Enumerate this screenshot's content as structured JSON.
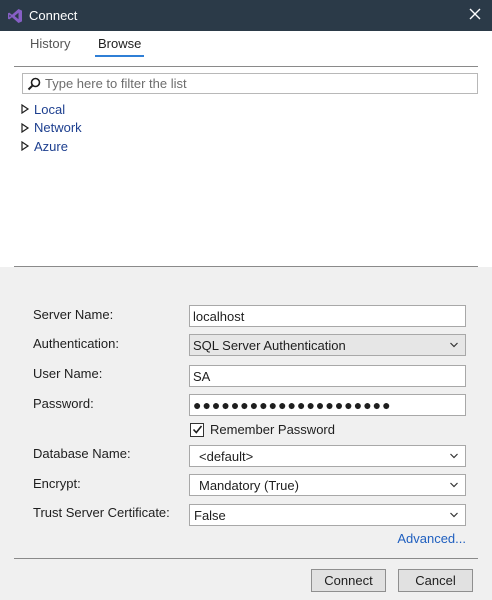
{
  "window": {
    "title": "Connect"
  },
  "tabs": [
    {
      "label": "History",
      "active": false
    },
    {
      "label": "Browse",
      "active": true
    }
  ],
  "filter": {
    "placeholder": "Type here to filter the list",
    "value": ""
  },
  "tree": [
    {
      "label": "Local"
    },
    {
      "label": "Network"
    },
    {
      "label": "Azure"
    }
  ],
  "form": {
    "server_name": {
      "label": "Server Name:",
      "value": "localhost"
    },
    "authentication": {
      "label": "Authentication:",
      "value": "SQL Server Authentication"
    },
    "user_name": {
      "label": "User Name:",
      "value": "SA"
    },
    "password": {
      "label": "Password:",
      "value": "●●●●●●●●●●●●●●●●●●●●●"
    },
    "remember_password": {
      "label": "Remember Password",
      "checked": true
    },
    "database_name": {
      "label": "Database Name:",
      "value": "<default>"
    },
    "encrypt": {
      "label": "Encrypt:",
      "value": "Mandatory (True)"
    },
    "trust_server_certificate": {
      "label": "Trust Server Certificate:",
      "value": "False"
    },
    "advanced_label": "Advanced..."
  },
  "buttons": {
    "connect": "Connect",
    "cancel": "Cancel"
  },
  "colors": {
    "titlebar": "#2b3a48",
    "accent": "#2f7fd6",
    "link": "#1f5fbf",
    "tree_text": "#1d3f8f",
    "vs_purple": "#865fc5"
  }
}
